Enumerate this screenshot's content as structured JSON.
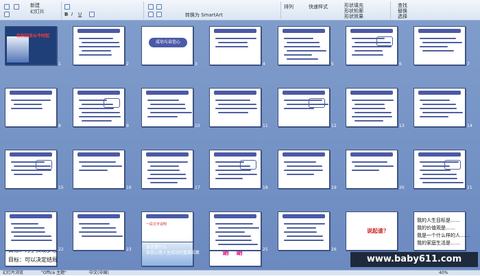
{
  "ribbon": {
    "new_slide_label": "新建\n幻灯片",
    "arrange_label": "排列",
    "quick_style_label": "快速样式",
    "convert_smartart_label": "转换为 SmartArt",
    "shape_fill_label": "形状填充",
    "shape_outline_label": "形状轮廓",
    "shape_effect_label": "形状效果",
    "find_label": "查找",
    "replace_label": "替换",
    "select_label": "选择"
  },
  "slides": {
    "s1_title": "告别过去从今时起",
    "s3_title": "成功与自信心",
    "s26_text": "一段文字说明",
    "s30_text": "说起谁？",
    "s29_lines": [
      "我的人生目标是……",
      "我的价值观是……",
      "我是一个什么样的人……",
      "我的家庭生活是……"
    ],
    "s31_lines": [
      "目标：为了实现梦想",
      "目标：可以决定结局"
    ],
    "s33_caption": "自信是什么\n自信心是人生成功的重要因素",
    "s34_title": "谢　谢"
  },
  "watermark": "www.baby611.com",
  "status": {
    "slide_sorter": "幻灯片浏览",
    "theme": "\"Office 主题\"",
    "language": "中文(中国)",
    "zoom": "40%"
  }
}
